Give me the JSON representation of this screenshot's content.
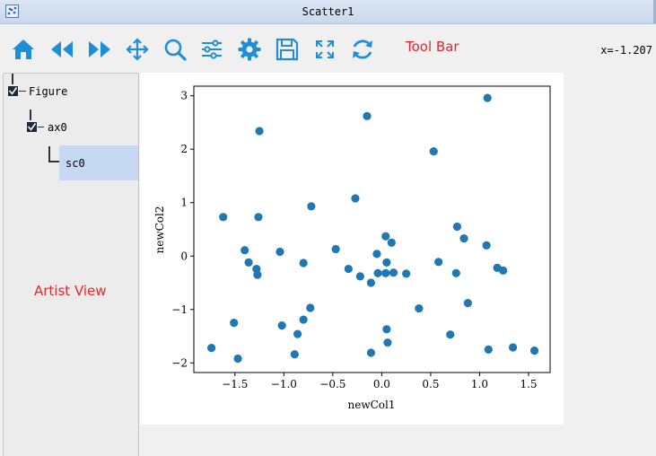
{
  "window": {
    "title": "Scatter1"
  },
  "toolbar": {
    "label": "Tool Bar",
    "buttons": [
      {
        "name": "home-icon"
      },
      {
        "name": "back-icon"
      },
      {
        "name": "forward-icon"
      },
      {
        "name": "pan-icon"
      },
      {
        "name": "zoom-icon"
      },
      {
        "name": "subplots-icon"
      },
      {
        "name": "settings-icon"
      },
      {
        "name": "save-icon"
      },
      {
        "name": "fit-icon"
      },
      {
        "name": "refresh-icon"
      }
    ],
    "accent": "#1e8fd6"
  },
  "coordinates": "x=-1.207",
  "artist_view": {
    "label": "Artist View",
    "tree": [
      {
        "label": "Figure",
        "checked": true
      },
      {
        "label": "ax0",
        "checked": true
      },
      {
        "label": "sc0",
        "selected": true
      }
    ]
  },
  "chart_data": {
    "type": "scatter",
    "title": "",
    "xlabel": "newCol1",
    "ylabel": "newCol2",
    "xlim": [
      -1.92,
      1.72
    ],
    "ylim": [
      -2.18,
      3.18
    ],
    "xticks": [
      -1.5,
      -1.0,
      -0.5,
      0.0,
      0.5,
      1.0,
      1.5
    ],
    "xtick_labels": [
      "−1.5",
      "−1.0",
      "−0.5",
      "0.0",
      "0.5",
      "1.0",
      "1.5"
    ],
    "yticks": [
      -2,
      -1,
      0,
      1,
      2,
      3
    ],
    "ytick_labels": [
      "−2",
      "−1",
      "0",
      "1",
      "2",
      "3"
    ],
    "marker_color": "#1f77b4",
    "grid": false,
    "points": [
      [
        -1.74,
        -1.72
      ],
      [
        -1.62,
        0.73
      ],
      [
        -1.51,
        -1.25
      ],
      [
        -1.47,
        -1.92
      ],
      [
        -1.4,
        0.11
      ],
      [
        -1.36,
        -0.12
      ],
      [
        -1.28,
        -0.24
      ],
      [
        -1.27,
        -0.35
      ],
      [
        -1.26,
        0.73
      ],
      [
        -1.25,
        2.34
      ],
      [
        -1.04,
        0.08
      ],
      [
        -1.02,
        -1.3
      ],
      [
        -0.89,
        -1.84
      ],
      [
        -0.86,
        -1.46
      ],
      [
        -0.8,
        -0.13
      ],
      [
        -0.8,
        -1.19
      ],
      [
        -0.73,
        -0.97
      ],
      [
        -0.72,
        0.93
      ],
      [
        -0.47,
        0.13
      ],
      [
        -0.34,
        -0.24
      ],
      [
        -0.27,
        1.08
      ],
      [
        -0.22,
        -0.38
      ],
      [
        -0.15,
        2.62
      ],
      [
        -0.11,
        -0.5
      ],
      [
        -0.11,
        -1.81
      ],
      [
        -0.05,
        0.04
      ],
      [
        -0.04,
        -0.32
      ],
      [
        0.04,
        0.37
      ],
      [
        0.04,
        -0.32
      ],
      [
        0.05,
        -0.12
      ],
      [
        0.05,
        -1.37
      ],
      [
        0.06,
        -1.62
      ],
      [
        0.1,
        0.25
      ],
      [
        0.12,
        -0.31
      ],
      [
        0.25,
        -0.33
      ],
      [
        0.38,
        -0.98
      ],
      [
        0.53,
        1.96
      ],
      [
        0.58,
        -0.11
      ],
      [
        0.7,
        -1.47
      ],
      [
        0.76,
        -0.32
      ],
      [
        0.77,
        0.55
      ],
      [
        0.84,
        0.33
      ],
      [
        0.88,
        -0.88
      ],
      [
        1.07,
        0.2
      ],
      [
        1.08,
        2.96
      ],
      [
        1.09,
        -1.75
      ],
      [
        1.18,
        -0.22
      ],
      [
        1.24,
        -0.27
      ],
      [
        1.34,
        -1.71
      ],
      [
        1.56,
        -1.77
      ]
    ]
  }
}
